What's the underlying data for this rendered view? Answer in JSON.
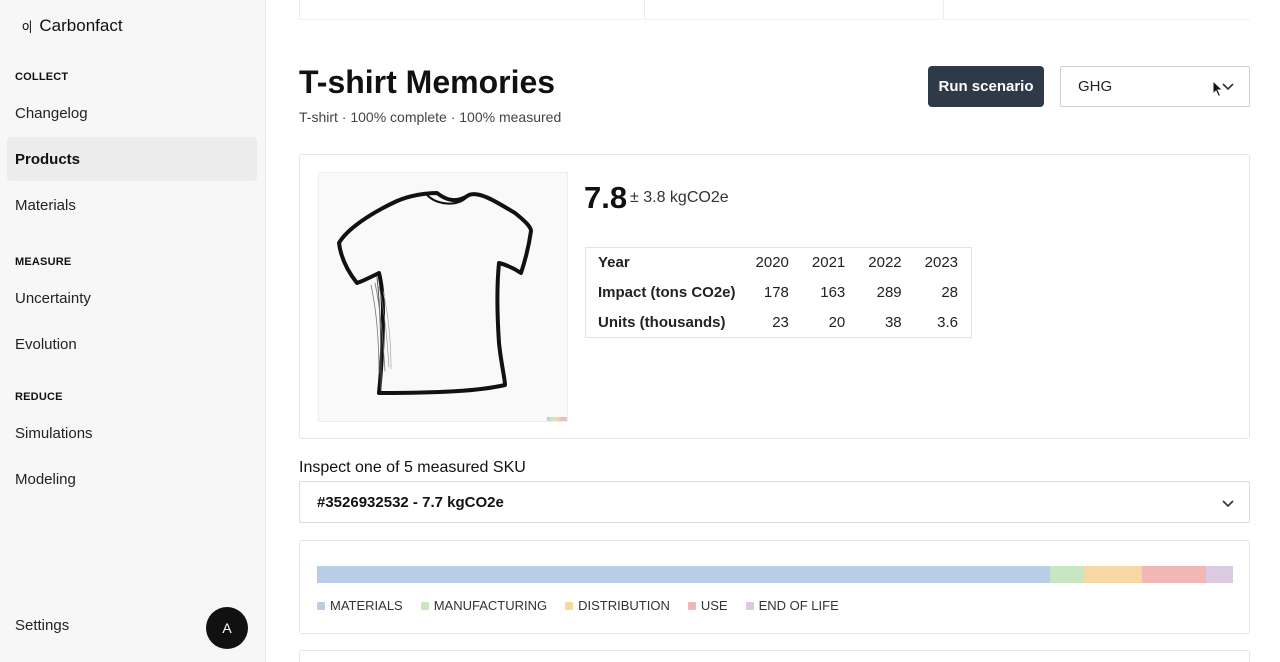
{
  "brand": {
    "mark": "o|",
    "name": "Carbonfact"
  },
  "sidebar": {
    "sections": [
      {
        "label": "COLLECT"
      },
      {
        "label": "MEASURE"
      },
      {
        "label": "REDUCE"
      }
    ],
    "items": [
      {
        "label": "Changelog"
      },
      {
        "label": "Products",
        "active": true
      },
      {
        "label": "Materials"
      },
      {
        "label": "Uncertainty"
      },
      {
        "label": "Evolution"
      },
      {
        "label": "Simulations"
      },
      {
        "label": "Modeling"
      }
    ],
    "settings_label": "Settings",
    "avatar_initial": "A"
  },
  "header": {
    "title": "T-shirt Memories",
    "subtitle": "T-shirt · 100% complete · 100% measured",
    "run_button": "Run scenario",
    "methodology": {
      "selected": "GHG"
    }
  },
  "product": {
    "image_icon": "tshirt-sketch-icon",
    "impact_value": "7.8",
    "impact_uncertainty": "± 3.8 kgCO2e",
    "table": {
      "headers": [
        "Year",
        "2020",
        "2021",
        "2022",
        "2023"
      ],
      "rows": [
        {
          "label": "Impact (tons CO2e)",
          "values": [
            "178",
            "163",
            "289",
            "28"
          ]
        },
        {
          "label": "Units (thousands)",
          "values": [
            "23",
            "20",
            "38",
            "3.6"
          ]
        }
      ]
    }
  },
  "inspect": {
    "label": "Inspect one of 5 measured SKU",
    "selected_sku": "#3526932532 - 7.7 kgCO2e"
  },
  "breakdown": {
    "segments": [
      {
        "label": "MATERIALS",
        "share": 0.8,
        "color": "#b9cde6"
      },
      {
        "label": "MANUFACTURING",
        "share": 0.036,
        "color": "#c9e6c3"
      },
      {
        "label": "DISTRIBUTION",
        "share": 0.065,
        "color": "#f7d7a4"
      },
      {
        "label": "USE",
        "share": 0.07,
        "color": "#f1b7b5"
      },
      {
        "label": "END OF LIFE",
        "share": 0.029,
        "color": "#dacbe3"
      }
    ]
  },
  "colors": {
    "primary_button": "#2f3a48",
    "active_nav": "#ececec"
  }
}
